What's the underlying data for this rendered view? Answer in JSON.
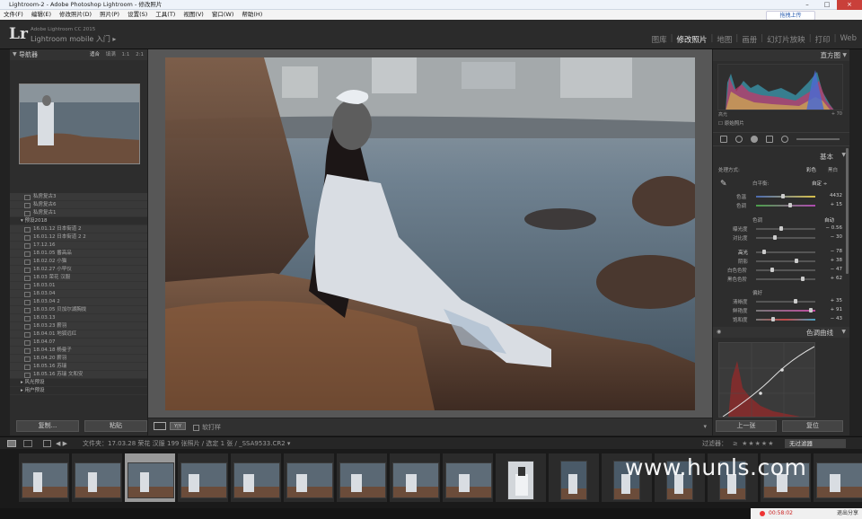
{
  "window": {
    "title": "Lightroom-2 - Adobe Photoshop Lightroom - 修改照片",
    "controls": [
      "–",
      "□",
      "×"
    ]
  },
  "menu": [
    "文件(F)",
    "编辑(E)",
    "修改照片(D)",
    "照片(P)",
    "设置(S)",
    "工具(T)",
    "视图(V)",
    "窗口(W)",
    "帮助(H)"
  ],
  "cloud_button": "拖拽上传",
  "identity": {
    "logo": "Lr",
    "version": "Adobe Lightroom CC 2015",
    "mobile": "Lightroom mobile 入门 ▸"
  },
  "modules": [
    "图库",
    "修改照片",
    "地图",
    "画册",
    "幻灯片放映",
    "打印",
    "Web"
  ],
  "active_module": "修改照片",
  "navigator": {
    "title": "导航器",
    "zooms": [
      "适合",
      "填满",
      "1:1",
      "2:1"
    ],
    "selected_zoom": "适合"
  },
  "presets": [
    {
      "label": "私房复古3",
      "folder": false
    },
    {
      "label": "私房复古6",
      "folder": false
    },
    {
      "label": "私房复古1",
      "folder": false
    },
    {
      "label": "▾ 预设2018",
      "folder": true
    },
    {
      "label": "16.01.12 日本街道 2",
      "folder": false
    },
    {
      "label": "16.01.12 日本街道 2 2",
      "folder": false
    },
    {
      "label": "17.12.16",
      "folder": false
    },
    {
      "label": "18.01.05 番高品",
      "folder": false
    },
    {
      "label": "18.02.02 小猫",
      "folder": false
    },
    {
      "label": "18.02.27 小早仪",
      "folder": false
    },
    {
      "label": "18.03 荣花 汉服",
      "folder": false
    },
    {
      "label": "18.03.01",
      "folder": false
    },
    {
      "label": "18.03.04",
      "folder": false
    },
    {
      "label": "18.03.04 2",
      "folder": false
    },
    {
      "label": "18.03.05 贝加尔湖胸拢",
      "folder": false
    },
    {
      "label": "18.03.13",
      "folder": false
    },
    {
      "label": "18.03.23 薪羽",
      "folder": false
    },
    {
      "label": "18.04.01 地狐远红",
      "folder": false
    },
    {
      "label": "18.04.07",
      "folder": false
    },
    {
      "label": "18.04.18 杨曼子",
      "folder": false
    },
    {
      "label": "18.04.20 薪羽",
      "folder": false
    },
    {
      "label": "18.05.16 苏瑞",
      "folder": false
    },
    {
      "label": "18.05.16 苏瑞 文和安",
      "folder": false
    },
    {
      "label": "▸ 风光预设",
      "folder": true
    },
    {
      "label": "▸ 用户预设",
      "folder": true
    }
  ],
  "left_buttons": {
    "copy": "复制...",
    "paste": "粘贴"
  },
  "toolbar": {
    "yy": "Y|Y",
    "proof": "软打样",
    "ddown": "▾"
  },
  "histogram": {
    "title": "直方图",
    "info_left": "高光",
    "info_right": "+ 70",
    "original": "原始照片"
  },
  "basic": {
    "title": "基本",
    "treatment": "处理方式:",
    "color": "彩色",
    "bw": "黑白",
    "wb": "白平衡:",
    "wb_value": "自定 ÷",
    "temp": {
      "label": "色温",
      "value": "4432",
      "pos": 0.45
    },
    "tint": {
      "label": "色调",
      "value": "+ 15",
      "pos": 0.58
    },
    "tone": "色调",
    "auto": "自动",
    "exposure": {
      "label": "曝光度",
      "value": "− 0.56",
      "pos": 0.42
    },
    "contrast": {
      "label": "对比度",
      "value": "− 30",
      "pos": 0.3
    },
    "highlights": {
      "label": "高光",
      "value": "− 78",
      "pos": 0.11
    },
    "shadows": {
      "label": "阴影",
      "value": "+ 38",
      "pos": 0.69
    },
    "whites": {
      "label": "白色色阶",
      "value": "− 47",
      "pos": 0.26
    },
    "blacks": {
      "label": "黑色色阶",
      "value": "+ 62",
      "pos": 0.81
    },
    "presence": "偏好",
    "clarity": {
      "label": "清晰度",
      "value": "+ 35",
      "pos": 0.68
    },
    "vibrance": {
      "label": "鲜艳度",
      "value": "+ 91",
      "pos": 0.95
    },
    "saturation": {
      "label": "饱和度",
      "value": "− 43",
      "pos": 0.28
    }
  },
  "tone_curve": {
    "title": "色调曲线"
  },
  "right_buttons": {
    "previous": "上一张",
    "reset": "复位"
  },
  "filmstrip_bar": {
    "source": "文件夹：17.03.28 荣花 汉服",
    "count": "199 张照片 / 选定 1 张 / _SSA9533.CR2 ▾",
    "filter_label": "过滤器：",
    "stars": "≥ ★★★★★",
    "filter_value": "无过滤器"
  },
  "watermark": "www.hunls.com",
  "tray": {
    "time": "00:58:02",
    "exit": "退出分享"
  },
  "colors": {
    "accent": "#dddddd",
    "panel": "#2d2d2d",
    "record": "#e33333"
  }
}
